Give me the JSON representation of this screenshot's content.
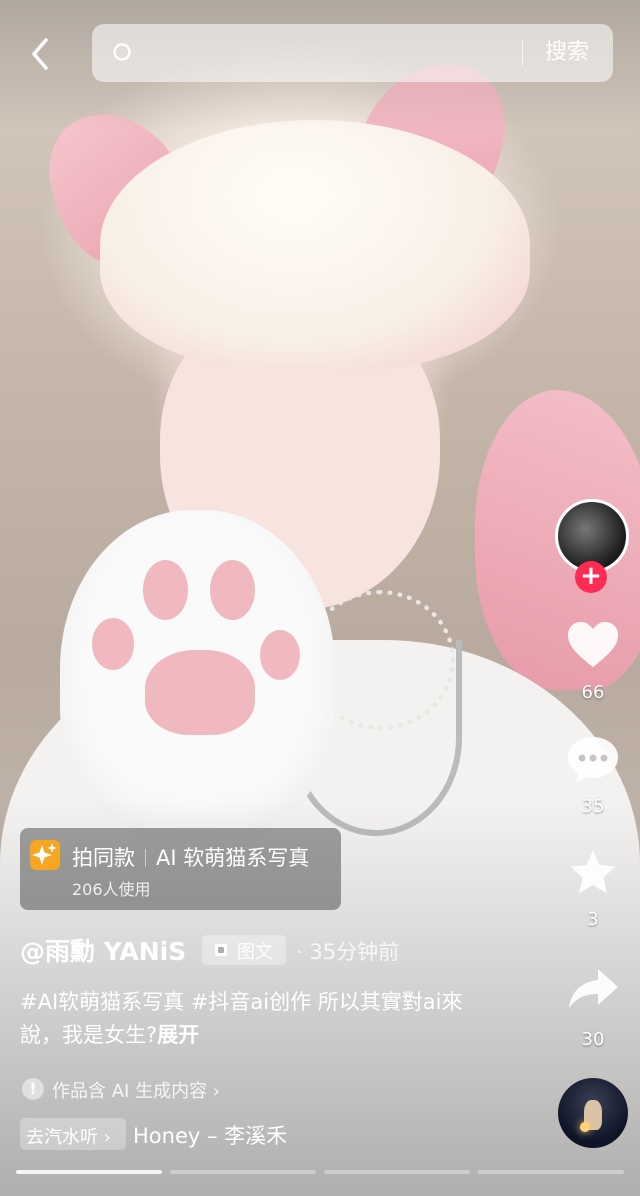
{
  "search": {
    "placeholder": "",
    "button_label": "搜索"
  },
  "creator": {
    "follow_symbol": "+"
  },
  "actions": {
    "likes": "66",
    "comments": "35",
    "favorites": "3",
    "shares": "30"
  },
  "template": {
    "action_label": "拍同款",
    "name": "AI 软萌猫系写真",
    "usage": "206人使用"
  },
  "post": {
    "author": "@雨勳 YANiS",
    "type_badge": "图文",
    "time": "· 35分钟前",
    "caption_text": "#AI软萌猫系写真 #抖音ai创作 所以其實對ai來說，我是女生?",
    "expand_label": "展开"
  },
  "ai_notice": {
    "icon_symbol": "!",
    "text": "作品含 AI 生成内容 ›"
  },
  "music": {
    "tag_label": "去汽水听 ›",
    "title": "Honey – 李溪禾"
  },
  "progress": {
    "total_pages": 4,
    "current_page": 1
  },
  "icons": {
    "back": "chevron-left-icon",
    "search": "search-icon",
    "like": "heart-icon",
    "comment": "comment-bubble-icon",
    "favorite": "star-icon",
    "share": "share-arrow-icon",
    "template": "sparkle-icon",
    "post_type": "image-post-icon",
    "ai_notice": "info-icon"
  },
  "colors": {
    "accent": "#fe2c55",
    "template_icon": "#f5a623"
  }
}
